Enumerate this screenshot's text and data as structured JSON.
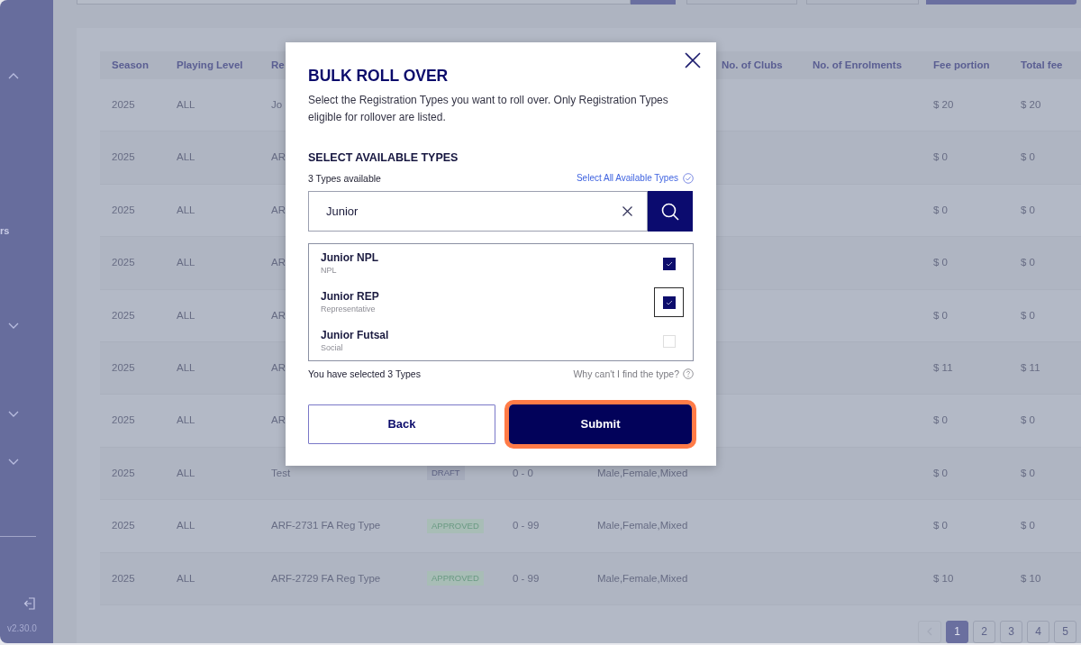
{
  "sidebar": {
    "items": [
      {
        "kind": "group",
        "expanded": true
      },
      {
        "kind": "label",
        "label": "rs"
      },
      {
        "kind": "group",
        "expanded": false
      },
      {
        "kind": "group",
        "expanded": false
      },
      {
        "kind": "group",
        "expanded": false
      }
    ],
    "version": "v2.30.0"
  },
  "table": {
    "header": {
      "season": "Season",
      "playing_level": "Playing Level",
      "name": "Re",
      "clubs": "No. of Clubs",
      "enrolments": "No. of Enrolments",
      "fee_portion": "Fee portion",
      "total_fee": "Total fee"
    },
    "rows": [
      {
        "season": "2025",
        "playing_level": "ALL",
        "name": "Jo",
        "fee_portion": "$ 20",
        "total_fee": "$ 20"
      },
      {
        "season": "2025",
        "playing_level": "ALL",
        "name": "AR",
        "fee_portion": "$ 0",
        "total_fee": "$ 0"
      },
      {
        "season": "2025",
        "playing_level": "ALL",
        "name": "AR",
        "fee_portion": "$ 0",
        "total_fee": "$ 0"
      },
      {
        "season": "2025",
        "playing_level": "ALL",
        "name": "AR",
        "fee_portion": "$ 0",
        "total_fee": "$ 0"
      },
      {
        "season": "2025",
        "playing_level": "ALL",
        "name": "AR",
        "fee_portion": "$ 0",
        "total_fee": "$ 0"
      },
      {
        "season": "2025",
        "playing_level": "ALL",
        "name": "AR",
        "fee_portion": "$ 11",
        "total_fee": "$ 11"
      },
      {
        "season": "2025",
        "playing_level": "ALL",
        "name": "AR",
        "fee_portion": "$ 0",
        "total_fee": "$ 0"
      },
      {
        "season": "2025",
        "playing_level": "ALL",
        "name": "Test",
        "status": {
          "kind": "draft",
          "label": "DRAFT"
        },
        "age": "0 - 0",
        "gender": "Male,Female,Mixed",
        "fee_portion": "$ 0",
        "total_fee": "$ 0"
      },
      {
        "season": "2025",
        "playing_level": "ALL",
        "name": "ARF-2731 FA Reg Type",
        "status": {
          "kind": "approved",
          "label": "APPROVED"
        },
        "age": "0 - 99",
        "gender": "Male,Female,Mixed",
        "fee_portion": "$ 0",
        "total_fee": "$ 0"
      },
      {
        "season": "2025",
        "playing_level": "ALL",
        "name": "ARF-2729 FA Reg Type",
        "status": {
          "kind": "approved",
          "label": "APPROVED"
        },
        "age": "0 - 99",
        "gender": "Male,Female,Mixed",
        "fee_portion": "$ 10",
        "total_fee": "$ 10"
      }
    ]
  },
  "pagination": {
    "previous_disabled": true,
    "pages": [
      {
        "label": "1",
        "selected": true
      },
      {
        "label": "2",
        "selected": false
      },
      {
        "label": "3",
        "selected": false
      },
      {
        "label": "4",
        "selected": false
      },
      {
        "label": "5",
        "selected": false
      }
    ]
  },
  "modal": {
    "title": "BULK ROLL OVER",
    "description": "Select the Registration Types you want to roll over. Only Registration Types eligible for rollover are listed.",
    "section_title": "SELECT AVAILABLE TYPES",
    "available_count": "3 Types available",
    "select_all_link": "Select All Available Types",
    "search": {
      "value": "Junior"
    },
    "types": [
      {
        "name": "Junior NPL",
        "category": "NPL",
        "checked": true,
        "focused": false
      },
      {
        "name": "Junior REP",
        "category": "Representative",
        "checked": true,
        "focused": true
      },
      {
        "name": "Junior Futsal",
        "category": "Social",
        "checked": false,
        "focused": false
      }
    ],
    "selected_summary": "You have selected 3 Types",
    "help_link": "Why can't I find the type?",
    "buttons": [
      {
        "kind": "secondary",
        "label": "Back",
        "highlighted": false
      },
      {
        "kind": "primary",
        "label": "Submit",
        "highlighted": true
      }
    ]
  }
}
